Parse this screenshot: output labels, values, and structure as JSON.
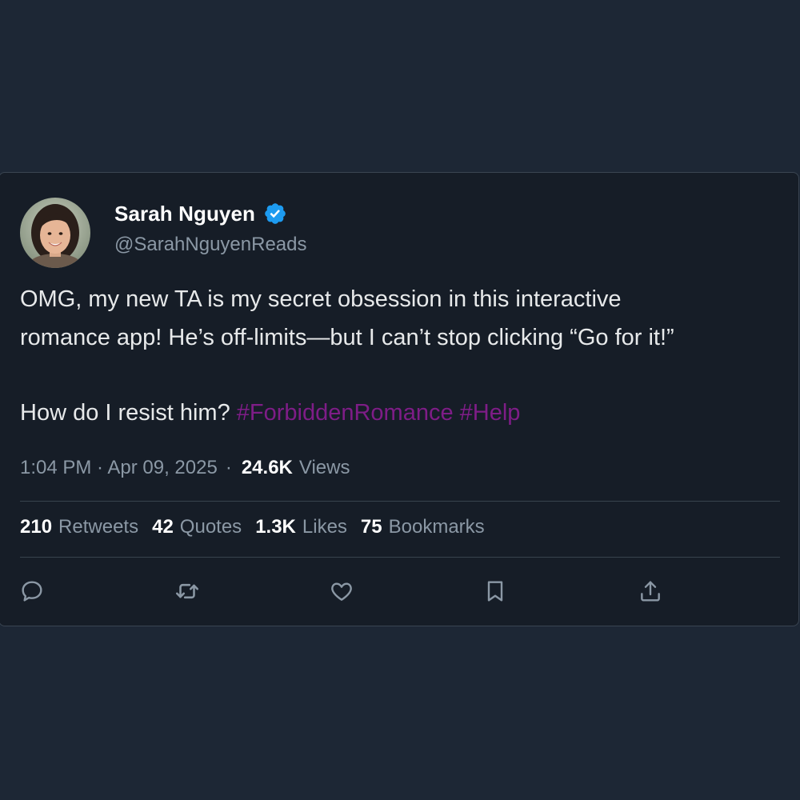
{
  "tweet": {
    "author": {
      "display_name": "Sarah Nguyen",
      "handle": "@SarahNguyenReads",
      "verified": true
    },
    "text_line1": "OMG, my new TA is my secret obsession in this interactive",
    "text_line2": "romance app! He’s off-limits—but I can’t stop clicking “Go for it!”",
    "text_line3_plain": "How do I resist him?",
    "hashtags": [
      "#ForbiddenRomance",
      "#Help"
    ],
    "timestamp": "1:04 PM · Apr 09, 2025",
    "separator": "·",
    "views_count": "24.6K",
    "views_label": "Views",
    "stats": {
      "retweets_count": "210",
      "retweets_label": "Retweets",
      "quotes_count": "42",
      "quotes_label": "Quotes",
      "likes_count": "1.3K",
      "likes_label": "Likes",
      "bookmarks_count": "75",
      "bookmarks_label": "Bookmarks"
    },
    "actions": [
      "reply-icon",
      "retweet-icon",
      "like-icon",
      "bookmark-icon",
      "share-icon"
    ]
  },
  "colors": {
    "page_background": "#1d2735",
    "card_background": "#161d27",
    "hashtag": "#7e1d87",
    "verified_badge": "#1d9bf0",
    "muted_text": "#8b98a5"
  }
}
